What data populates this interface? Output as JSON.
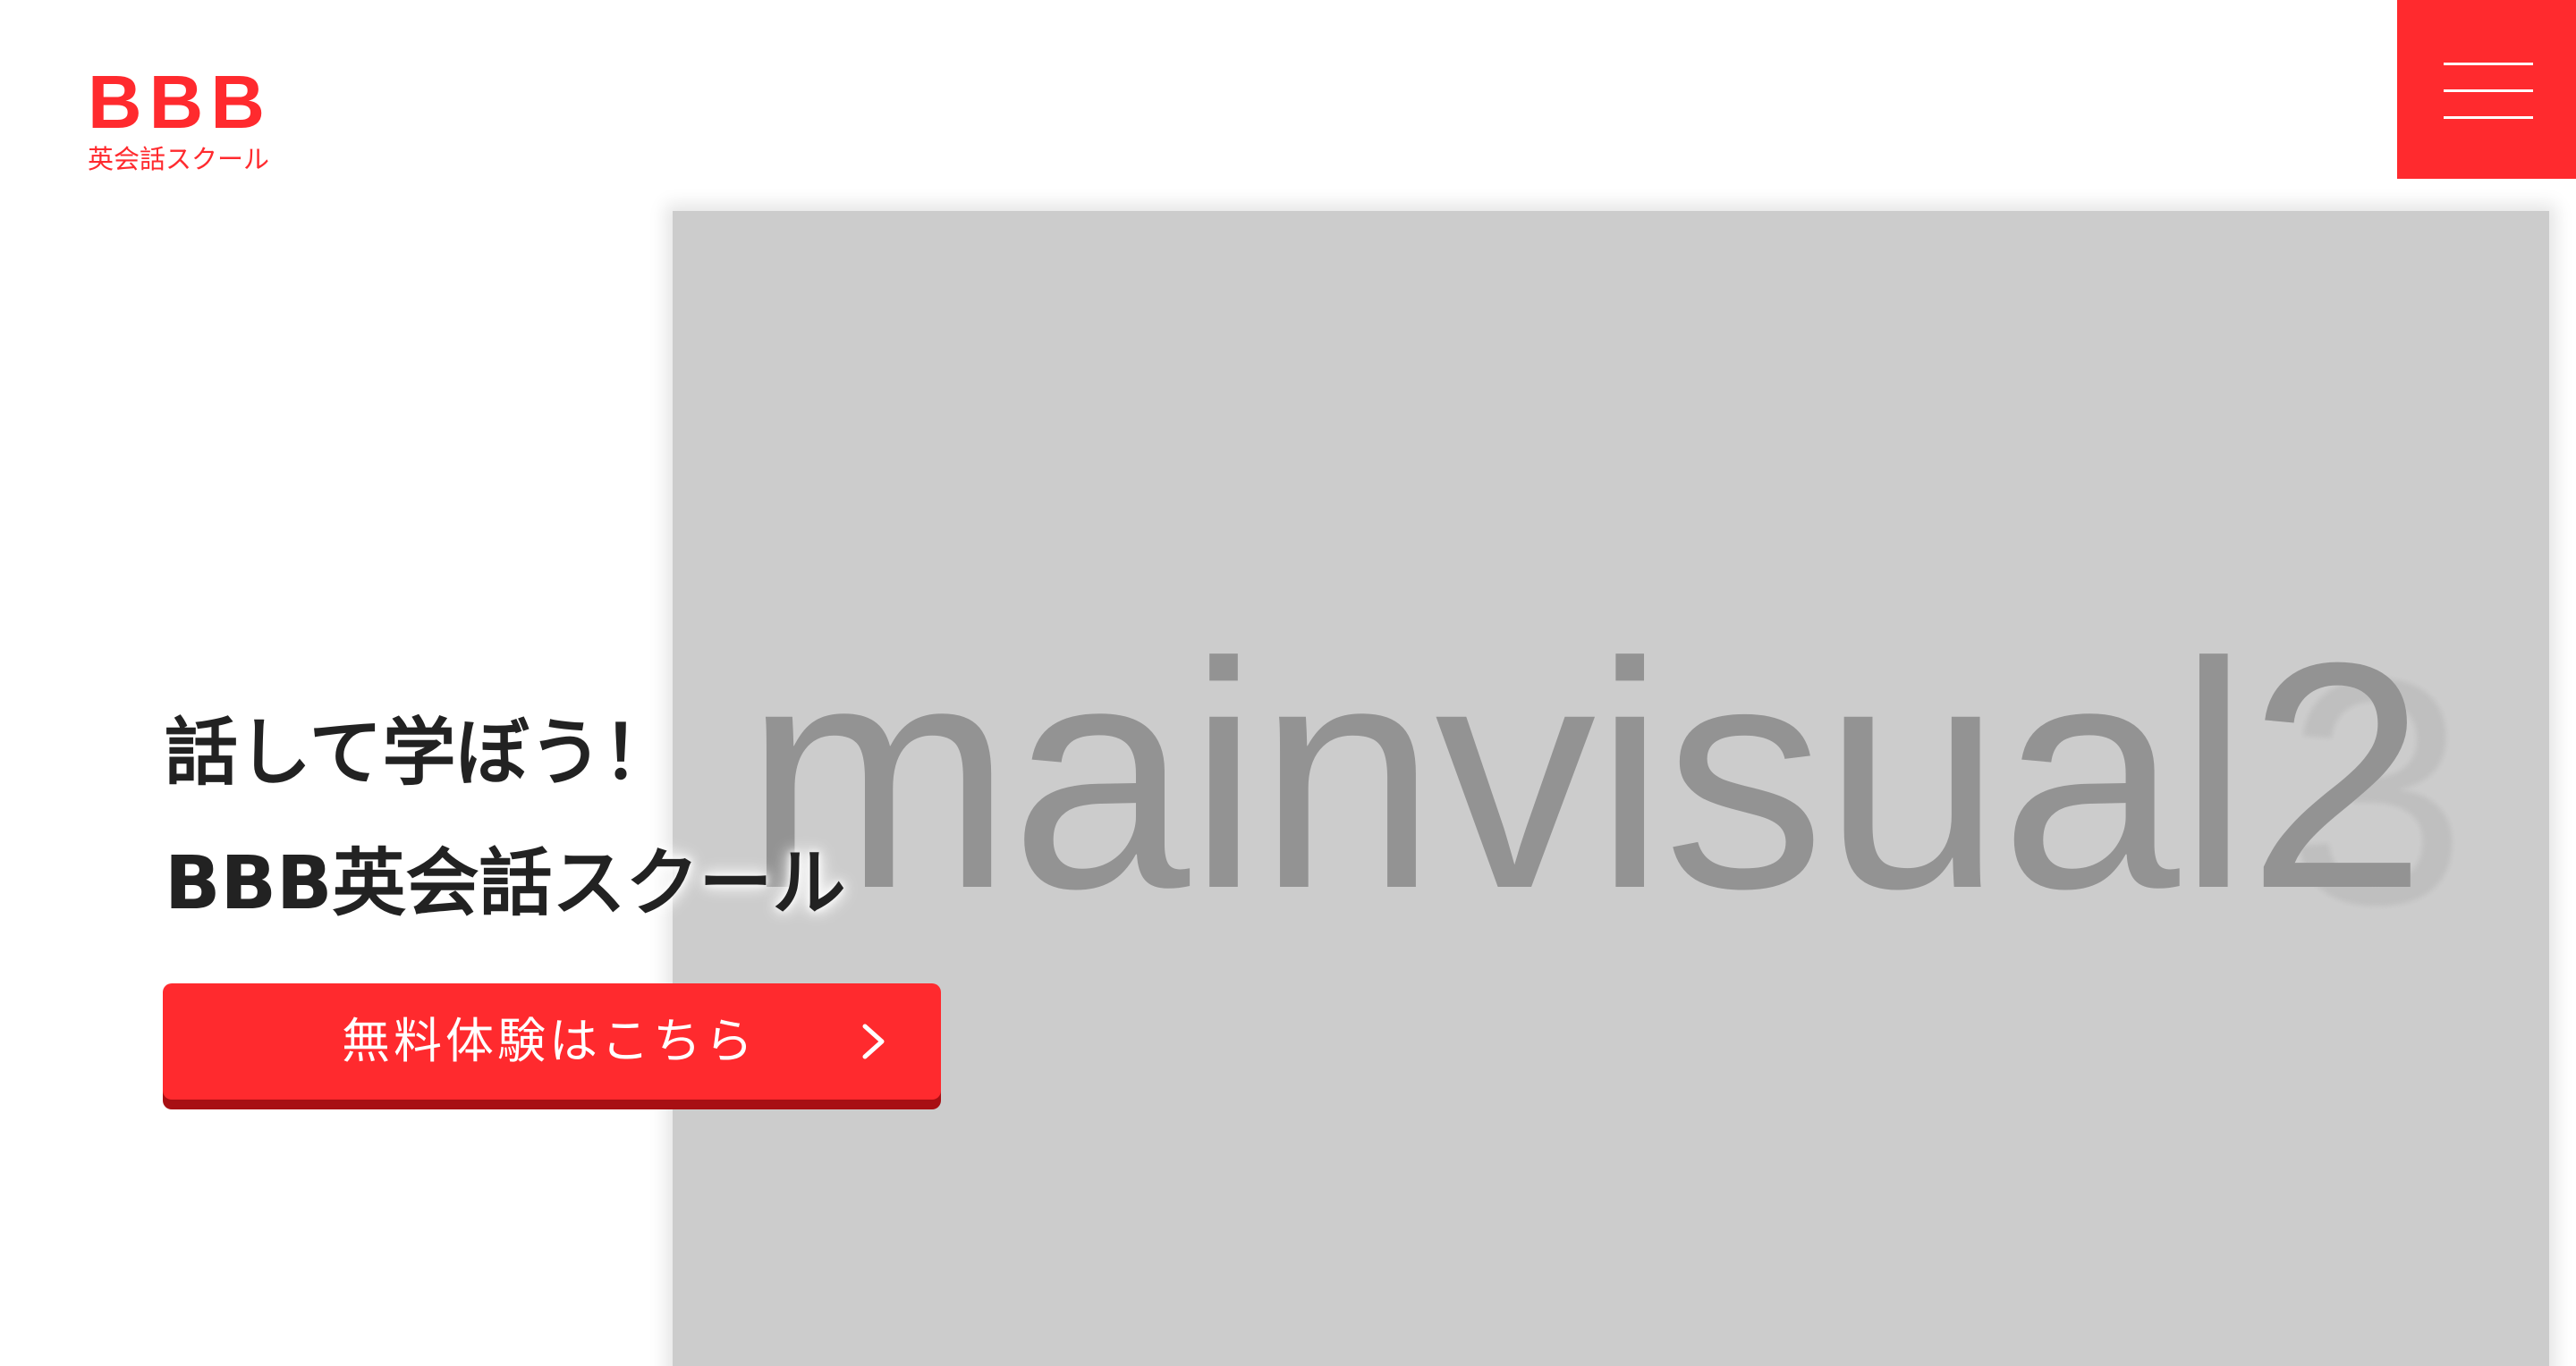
{
  "header": {
    "logo": {
      "main": "BBB",
      "sub": "英会話スクール"
    },
    "menu_icon": "hamburger-menu-icon"
  },
  "hero": {
    "visual_label": "mainvisual2",
    "visual_ghost": "3",
    "copy_line1": "話して学ぼう！",
    "copy_line2": "BBB英会話スクール",
    "cta_label": "無料体験はこちら",
    "cta_icon": "chevron-right-icon"
  },
  "colors": {
    "brand": "#ff2a2e",
    "brand_shadow": "#a80f13",
    "visual_bg": "#cccccc",
    "visual_text": "#939393",
    "copy_text": "#222222"
  }
}
